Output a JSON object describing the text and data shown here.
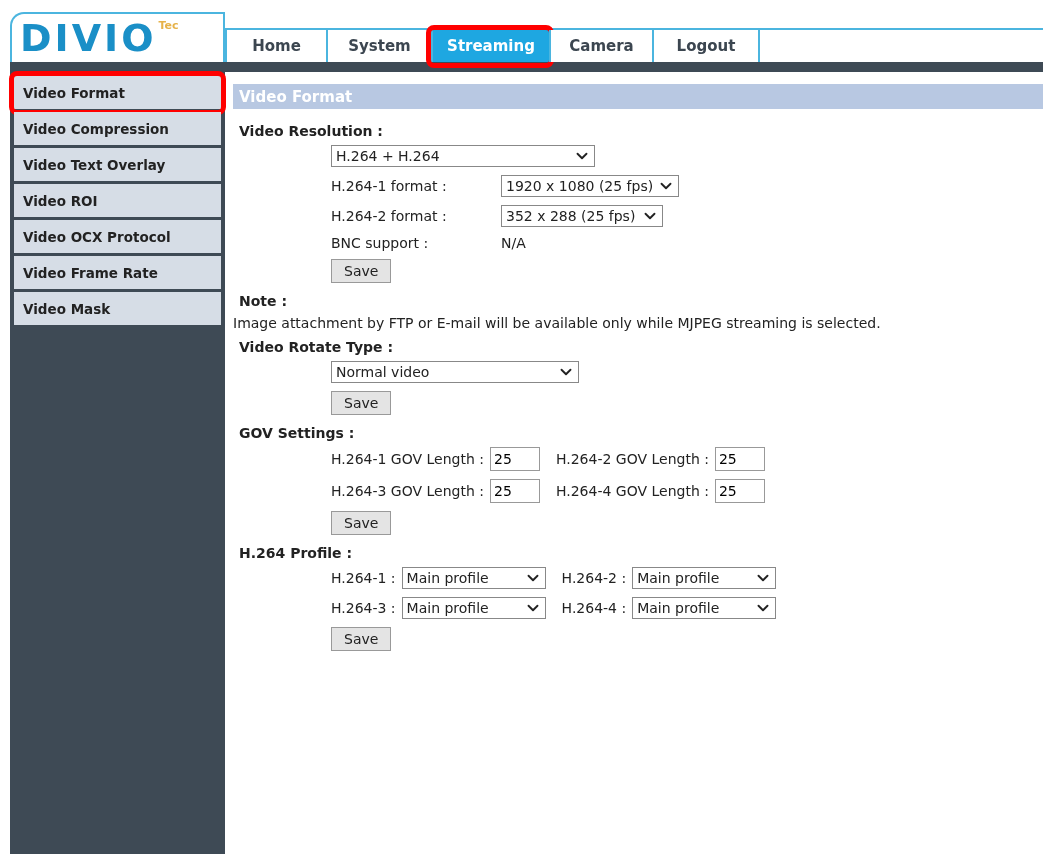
{
  "logo": {
    "name": "DIVIO",
    "suffix": "Tec"
  },
  "tabs": [
    {
      "label": "Home",
      "selected": false,
      "highlighted": false
    },
    {
      "label": "System",
      "selected": false,
      "highlighted": false
    },
    {
      "label": "Streaming",
      "selected": true,
      "highlighted": true
    },
    {
      "label": "Camera",
      "selected": false,
      "highlighted": false
    },
    {
      "label": "Logout",
      "selected": false,
      "highlighted": false
    }
  ],
  "sidebar": {
    "items": [
      {
        "label": "Video Format",
        "highlighted": true
      },
      {
        "label": "Video Compression",
        "highlighted": false
      },
      {
        "label": "Video Text Overlay",
        "highlighted": false
      },
      {
        "label": "Video ROI",
        "highlighted": false
      },
      {
        "label": "Video OCX Protocol",
        "highlighted": false
      },
      {
        "label": "Video Frame Rate",
        "highlighted": false
      },
      {
        "label": "Video Mask",
        "highlighted": false
      }
    ]
  },
  "panel_title": "Video Format",
  "sections": [
    {
      "kind": "form",
      "heading": "Video Resolution :",
      "select": "H.264 + H.264",
      "rows": [
        {
          "kind": "select",
          "label": "H.264-1 format :",
          "value": "1920 x 1080 (25 fps)"
        },
        {
          "kind": "select",
          "label": "H.264-2 format :",
          "value": "352 x 288 (25 fps)"
        },
        {
          "kind": "text",
          "label": "BNC support :",
          "value": "N/A"
        }
      ],
      "button": "Save"
    },
    {
      "kind": "note",
      "heading": "Note :",
      "text": "Image attachment by FTP or E-mail will be available only while MJPEG streaming is selected."
    },
    {
      "kind": "form",
      "heading": "Video Rotate Type :",
      "select": "Normal video",
      "button": "Save"
    },
    {
      "kind": "grid",
      "heading": "GOV Settings :",
      "fields": [
        {
          "kind": "input",
          "label": "H.264-1 GOV Length :",
          "value": "25"
        },
        {
          "kind": "input",
          "label": "H.264-2 GOV Length :",
          "value": "25"
        },
        {
          "kind": "input",
          "label": "H.264-3 GOV Length :",
          "value": "25"
        },
        {
          "kind": "input",
          "label": "H.264-4 GOV Length :",
          "value": "25"
        }
      ],
      "button": "Save"
    },
    {
      "kind": "grid",
      "heading": "H.264 Profile :",
      "fields": [
        {
          "kind": "select",
          "label": "H.264-1 :",
          "value": "Main profile"
        },
        {
          "kind": "select",
          "label": "H.264-2 :",
          "value": "Main profile"
        },
        {
          "kind": "select",
          "label": "H.264-3 :",
          "value": "Main profile"
        },
        {
          "kind": "select",
          "label": "H.264-4 :",
          "value": "Main profile"
        }
      ],
      "button": "Save"
    }
  ]
}
